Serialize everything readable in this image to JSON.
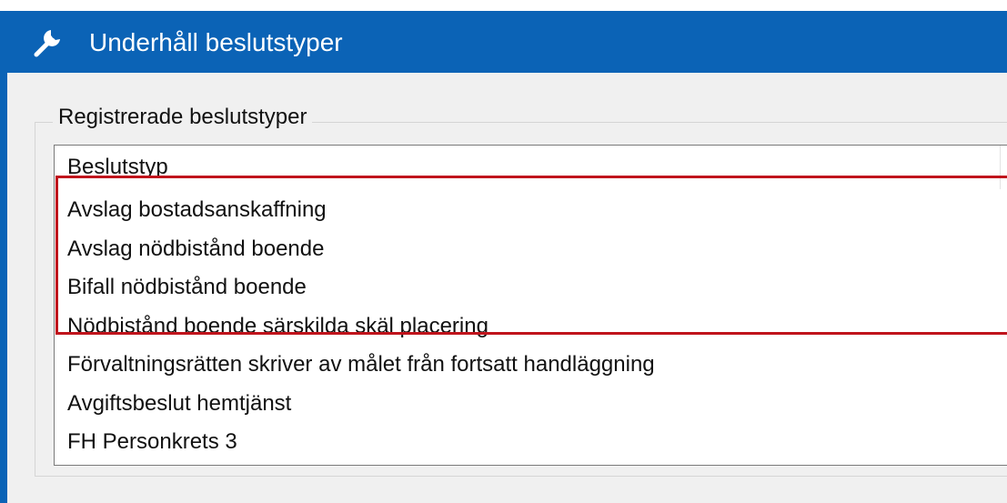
{
  "window": {
    "title": "Underhåll beslutstyper",
    "icon": "wrench-icon"
  },
  "groupbox": {
    "legend": "Registrerade beslutstyper"
  },
  "listview": {
    "column_header": "Beslutstyp",
    "rows": [
      "Avslag bostadsanskaffning",
      "Avslag nödbistånd boende",
      "Bifall nödbistånd boende",
      "Nödbistånd boende särskilda skäl placering",
      "Förvaltningsrätten skriver av målet från fortsatt handläggning",
      "Avgiftsbeslut hemtjänst",
      "FH Personkrets 3"
    ]
  },
  "highlight": {
    "color": "#c0141c",
    "highlighted_rows": [
      0,
      1,
      2,
      3
    ]
  },
  "colors": {
    "titlebar": "#0b63b6",
    "client": "#f0f0f0"
  }
}
